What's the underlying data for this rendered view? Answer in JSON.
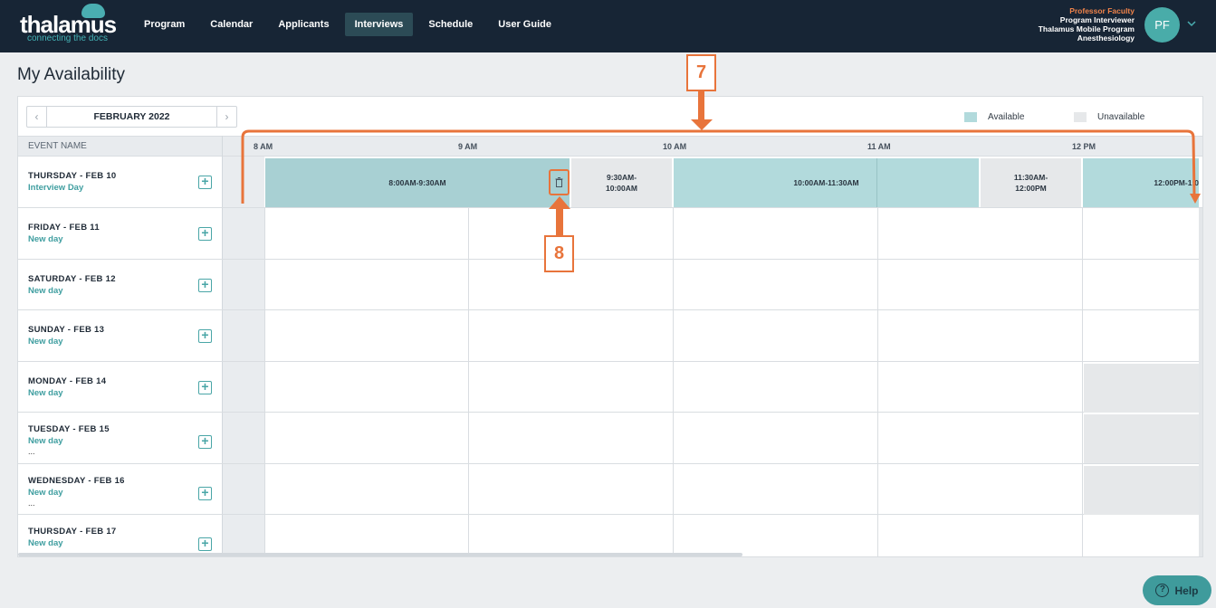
{
  "app": {
    "logo_text": "thalamus",
    "logo_tagline": "connecting the docs"
  },
  "nav": {
    "items": [
      {
        "label": "Program"
      },
      {
        "label": "Calendar"
      },
      {
        "label": "Applicants"
      },
      {
        "label": "Interviews",
        "active": true
      },
      {
        "label": "Schedule"
      },
      {
        "label": "User Guide"
      }
    ]
  },
  "user": {
    "name": "Professor Faculty",
    "role": "Program Interviewer",
    "program": "Thalamus Mobile Program",
    "department": "Anesthesiology",
    "initials": "PF"
  },
  "page": {
    "title": "My Availability"
  },
  "calendar": {
    "month_label": "FEBRUARY 2022",
    "prev_icon": "chevron-left-icon",
    "next_icon": "chevron-right-icon",
    "legend_available": "Available",
    "legend_unavailable": "Unavailable",
    "colors": {
      "available": "#b2dadc",
      "unavailable": "#e6e8ea",
      "accent": "#4aa6a7",
      "annotation": "#e8743b"
    },
    "event_name_header": "EVENT NAME",
    "time_labels": [
      "8 AM",
      "9 AM",
      "10 AM",
      "11 AM",
      "12 PM"
    ],
    "days": [
      {
        "title": "THURSDAY - FEB 10",
        "subtitle": "Interview Day"
      },
      {
        "title": "FRIDAY - FEB 11",
        "subtitle": "New day"
      },
      {
        "title": "SATURDAY - FEB 12",
        "subtitle": "New day"
      },
      {
        "title": "SUNDAY - FEB 13",
        "subtitle": "New day"
      },
      {
        "title": "MONDAY - FEB 14",
        "subtitle": "New day"
      },
      {
        "title": "TUESDAY - FEB 15",
        "subtitle": "New day",
        "more": "..."
      },
      {
        "title": "WEDNESDAY - FEB 16",
        "subtitle": "New day",
        "more": "..."
      },
      {
        "title": "THURSDAY - FEB 17",
        "subtitle": "New day"
      }
    ],
    "slots": [
      {
        "label": "8:00AM-9:30AM",
        "status": "available",
        "selected": true
      },
      {
        "label_line1": "9:30AM-",
        "label_line2": "10:00AM",
        "status": "unavailable"
      },
      {
        "label": "10:00AM-11:30AM",
        "status": "available"
      },
      {
        "label_line1": "11:30AM-",
        "label_line2": "12:00PM",
        "status": "unavailable"
      },
      {
        "label": "12:00PM-1:0",
        "status": "available"
      }
    ]
  },
  "annotations": {
    "seven": "7",
    "eight": "8"
  },
  "help": {
    "label": "Help"
  }
}
